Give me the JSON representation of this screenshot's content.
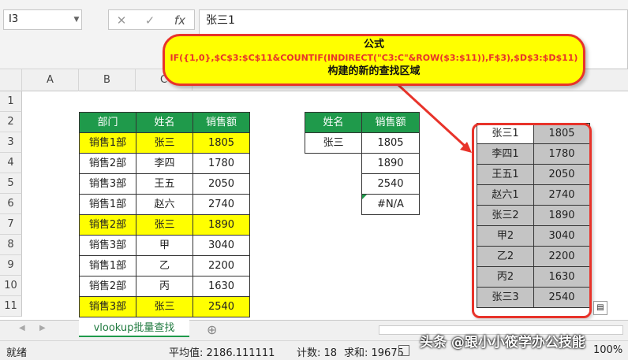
{
  "formula_bar": {
    "name_box": "I3",
    "cancel_symbol": "✕",
    "confirm_symbol": "✓",
    "fx_symbol": "fx",
    "content": "张三1"
  },
  "columns": [
    "A",
    "B",
    "C"
  ],
  "rows": [
    "1",
    "2",
    "3",
    "4",
    "5",
    "6",
    "7",
    "8",
    "9",
    "10",
    "11"
  ],
  "callout": {
    "line1": "公式",
    "line2": "IF({1,0},$C$3:$C$11&COUNTIF(INDIRECT(\"C3:C\"&ROW($3:$11)),F$3),$D$3:$D$11)",
    "line3": "构建的新的查找区域"
  },
  "main_table": {
    "headers": [
      "部门",
      "姓名",
      "销售额"
    ],
    "rows": [
      [
        "销售1部",
        "张三",
        "1805"
      ],
      [
        "销售2部",
        "李四",
        "1780"
      ],
      [
        "销售3部",
        "王五",
        "2050"
      ],
      [
        "销售1部",
        "赵六",
        "2740"
      ],
      [
        "销售2部",
        "张三",
        "1890"
      ],
      [
        "销售3部",
        "甲",
        "3040"
      ],
      [
        "销售1部",
        "乙",
        "2200"
      ],
      [
        "销售2部",
        "丙",
        "1630"
      ],
      [
        "销售3部",
        "张三",
        "2540"
      ]
    ]
  },
  "lookup_table": {
    "headers": [
      "姓名",
      "销售额"
    ],
    "name": "张三",
    "results": [
      "1805",
      "1890",
      "2540",
      "#N/A"
    ]
  },
  "helper_table": {
    "rows": [
      [
        "张三1",
        "1805"
      ],
      [
        "李四1",
        "1780"
      ],
      [
        "王五1",
        "2050"
      ],
      [
        "赵六1",
        "2740"
      ],
      [
        "张三2",
        "1890"
      ],
      [
        "甲2",
        "3040"
      ],
      [
        "乙2",
        "2200"
      ],
      [
        "丙2",
        "1630"
      ],
      [
        "张三3",
        "2540"
      ]
    ]
  },
  "sheet_tab": "vlookup批量查找",
  "add_sheet_symbol": "⊕",
  "status": {
    "mode": "就绪",
    "average": "平均值: 2186.111111",
    "count": "计数: 18",
    "sum": "求和: 19675",
    "zoom": "100%"
  },
  "watermark": "头条 @跟小小筱学办公技能",
  "colors": {
    "header_green": "#1f9a4b",
    "highlight_yellow": "#ffff00",
    "callout_red": "#e8332a",
    "helper_gray": "#c4c4c4"
  }
}
